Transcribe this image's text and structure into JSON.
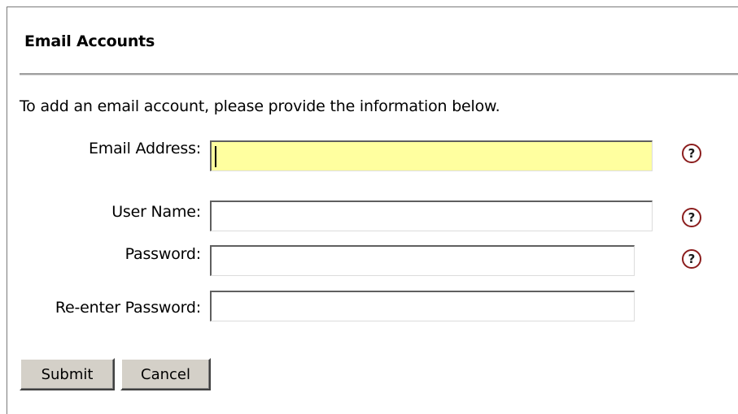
{
  "panel": {
    "title": "Email Accounts",
    "intro": "To add an email account, please provide the information below."
  },
  "form": {
    "email_address": {
      "label": "Email Address:",
      "value": "",
      "help": "?"
    },
    "user_name": {
      "label": "User Name:",
      "value": "",
      "help": "?"
    },
    "password": {
      "label": "Password:",
      "value": "",
      "help": "?"
    },
    "reenter_password": {
      "label": "Re-enter Password:",
      "value": ""
    }
  },
  "buttons": {
    "submit": "Submit",
    "cancel": "Cancel"
  },
  "colors": {
    "focused_field_bg": "#ffff9f",
    "help_icon_ring": "#8b1d1d",
    "button_face": "#d4d0c8",
    "divider": "#9f9f9f"
  },
  "icons": {
    "help": "question-circle-icon"
  }
}
